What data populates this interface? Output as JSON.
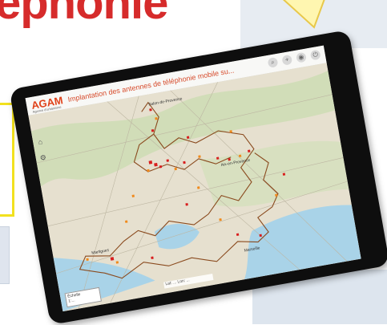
{
  "slide": {
    "title_fragment": "éphonie"
  },
  "app": {
    "logo_text": "AGAM",
    "logo_sub": "Agence d'urbanisme",
    "title": "Implantation des antennes de téléphonie mobile su..."
  },
  "left_tools": [
    "home-icon",
    "gear-icon"
  ],
  "right_tools": [
    "layers-icon",
    "share-icon",
    "edit-icon",
    "print-icon"
  ],
  "map": {
    "place_labels": [
      "Salon-de-Provence",
      "Aix-en-Provence",
      "Martigues",
      "Marseille"
    ],
    "colors": {
      "land": "#e6e0cf",
      "green": "#c8dcae",
      "water": "#a9d3e8",
      "boundary": "#8a4a1e",
      "antenna_red": "#d81e1e",
      "antenna_orange": "#f08a1c"
    }
  },
  "scale": {
    "label": "Échelle",
    "value": "1:..."
  },
  "coords": {
    "text": "Lat: ... Lon: ..."
  }
}
